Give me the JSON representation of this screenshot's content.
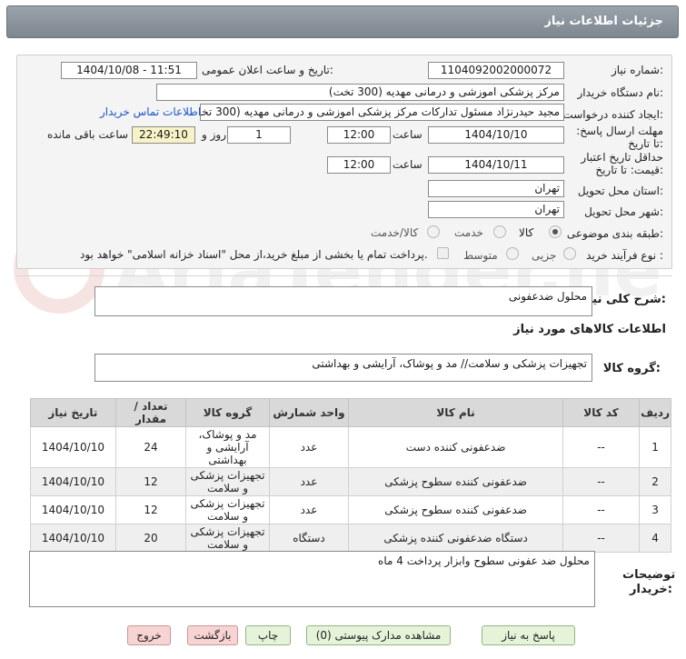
{
  "header": {
    "title": "جزئیات اطلاعات نیاز"
  },
  "form": {
    "need_number_label": "شماره نیاز:",
    "need_number": "1104092002000072",
    "announce_label": "تاریخ و ساعت اعلان عمومی:",
    "announce_value": "1404/10/08 - 11:51",
    "buyer_org_label": "نام دستگاه خریدار:",
    "buyer_org": "مرکز پزشکی  اموزشی و درمانی مهدیه (300 تخت)",
    "requester_label": "ایجاد کننده درخواست:",
    "requester": "مجید حیدرنژاد مسئول تدارکات مرکز پزشکی  اموزشی و درمانی مهدیه (300 تخت)",
    "contact_link": "اطلاعات تماس خریدار",
    "deadline_label": "مهلت ارسال پاسخ: تا تاریخ:",
    "deadline_date": "1404/10/10",
    "time_label": "ساعت",
    "deadline_time": "12:00",
    "days_value": "1",
    "days_label": "روز و",
    "remaining_time": "22:49:10",
    "remaining_label": "ساعت باقی مانده",
    "validity_label": "حداقل تاریخ اعتبار قیمت: تا تاریخ:",
    "validity_date": "1404/10/11",
    "validity_time": "12:00",
    "province_label": "استان محل تحویل:",
    "province": "تهران",
    "city_label": "شهر محل تحویل:",
    "city": "تهران",
    "category_label": "طبقه بندی موضوعی:",
    "category_options": [
      "کالا",
      "خدمت",
      "کالا/خدمت"
    ],
    "process_label": "نوع فرآیند خرید :",
    "process_options": [
      "جزیی",
      "متوسط"
    ],
    "payment_note": "پرداخت تمام یا بخشی از مبلغ خرید،از محل \"اسناد خزانه اسلامی\" خواهد بود."
  },
  "summary": {
    "label": "شرح کلی نیاز:",
    "value": "محلول ضدعفونی"
  },
  "goods_info_title": "اطلاعات کالاهای مورد نیاز",
  "goods_group": {
    "label": "گروه کالا:",
    "value": "تجهیزات پزشکی و سلامت// مد و پوشاک، آرایشی و بهداشتی"
  },
  "table": {
    "headers": [
      "ردیف",
      "کد کالا",
      "نام کالا",
      "واحد شمارش",
      "گروه کالا",
      "تعداد / مقدار",
      "تاریخ نیاز"
    ],
    "rows": [
      [
        "1",
        "--",
        "ضدعفونی کننده دست",
        "عدد",
        "مد و پوشاک، آرایشی و بهداشتی",
        "24",
        "1404/10/10"
      ],
      [
        "2",
        "--",
        "ضدعفونی کننده سطوح پزشکی",
        "عدد",
        "تجهیزات پزشکی و سلامت",
        "12",
        "1404/10/10"
      ],
      [
        "3",
        "--",
        "ضدعفونی کننده سطوح پزشکی",
        "عدد",
        "تجهیزات پزشکی و سلامت",
        "12",
        "1404/10/10"
      ],
      [
        "4",
        "--",
        "دستگاه ضدعفونی کننده پزشکی",
        "دستگاه",
        "تجهیزات پزشکی و سلامت",
        "20",
        "1404/10/10"
      ]
    ]
  },
  "buyer_notes": {
    "label": "توضیحات خریدار:",
    "value": "محلول ضد عفونی سطوح وابزار پرداخت 4 ماه"
  },
  "buttons": {
    "reply": "پاسخ به نیاز",
    "attachments": "مشاهده مدارک پیوستی (0)",
    "print": "چاپ",
    "back": "بازگشت",
    "exit": "خروج"
  },
  "watermark_text": "AriaTender.neT"
}
